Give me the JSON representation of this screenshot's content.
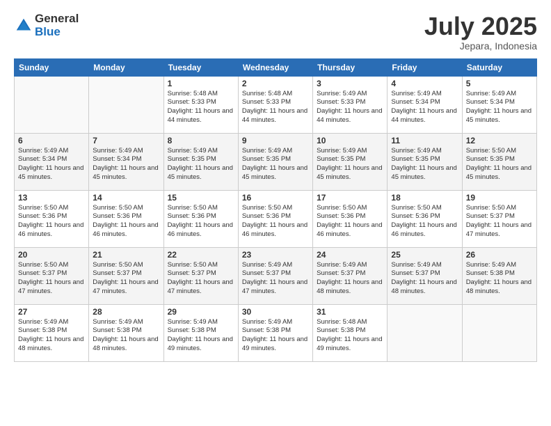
{
  "logo": {
    "general": "General",
    "blue": "Blue"
  },
  "title": "July 2025",
  "location": "Jepara, Indonesia",
  "weekdays": [
    "Sunday",
    "Monday",
    "Tuesday",
    "Wednesday",
    "Thursday",
    "Friday",
    "Saturday"
  ],
  "weeks": [
    [
      {
        "day": "",
        "sunrise": "",
        "sunset": "",
        "daylight": ""
      },
      {
        "day": "",
        "sunrise": "",
        "sunset": "",
        "daylight": ""
      },
      {
        "day": "1",
        "sunrise": "Sunrise: 5:48 AM",
        "sunset": "Sunset: 5:33 PM",
        "daylight": "Daylight: 11 hours and 44 minutes."
      },
      {
        "day": "2",
        "sunrise": "Sunrise: 5:48 AM",
        "sunset": "Sunset: 5:33 PM",
        "daylight": "Daylight: 11 hours and 44 minutes."
      },
      {
        "day": "3",
        "sunrise": "Sunrise: 5:49 AM",
        "sunset": "Sunset: 5:33 PM",
        "daylight": "Daylight: 11 hours and 44 minutes."
      },
      {
        "day": "4",
        "sunrise": "Sunrise: 5:49 AM",
        "sunset": "Sunset: 5:34 PM",
        "daylight": "Daylight: 11 hours and 44 minutes."
      },
      {
        "day": "5",
        "sunrise": "Sunrise: 5:49 AM",
        "sunset": "Sunset: 5:34 PM",
        "daylight": "Daylight: 11 hours and 45 minutes."
      }
    ],
    [
      {
        "day": "6",
        "sunrise": "Sunrise: 5:49 AM",
        "sunset": "Sunset: 5:34 PM",
        "daylight": "Daylight: 11 hours and 45 minutes."
      },
      {
        "day": "7",
        "sunrise": "Sunrise: 5:49 AM",
        "sunset": "Sunset: 5:34 PM",
        "daylight": "Daylight: 11 hours and 45 minutes."
      },
      {
        "day": "8",
        "sunrise": "Sunrise: 5:49 AM",
        "sunset": "Sunset: 5:35 PM",
        "daylight": "Daylight: 11 hours and 45 minutes."
      },
      {
        "day": "9",
        "sunrise": "Sunrise: 5:49 AM",
        "sunset": "Sunset: 5:35 PM",
        "daylight": "Daylight: 11 hours and 45 minutes."
      },
      {
        "day": "10",
        "sunrise": "Sunrise: 5:49 AM",
        "sunset": "Sunset: 5:35 PM",
        "daylight": "Daylight: 11 hours and 45 minutes."
      },
      {
        "day": "11",
        "sunrise": "Sunrise: 5:49 AM",
        "sunset": "Sunset: 5:35 PM",
        "daylight": "Daylight: 11 hours and 45 minutes."
      },
      {
        "day": "12",
        "sunrise": "Sunrise: 5:50 AM",
        "sunset": "Sunset: 5:35 PM",
        "daylight": "Daylight: 11 hours and 45 minutes."
      }
    ],
    [
      {
        "day": "13",
        "sunrise": "Sunrise: 5:50 AM",
        "sunset": "Sunset: 5:36 PM",
        "daylight": "Daylight: 11 hours and 46 minutes."
      },
      {
        "day": "14",
        "sunrise": "Sunrise: 5:50 AM",
        "sunset": "Sunset: 5:36 PM",
        "daylight": "Daylight: 11 hours and 46 minutes."
      },
      {
        "day": "15",
        "sunrise": "Sunrise: 5:50 AM",
        "sunset": "Sunset: 5:36 PM",
        "daylight": "Daylight: 11 hours and 46 minutes."
      },
      {
        "day": "16",
        "sunrise": "Sunrise: 5:50 AM",
        "sunset": "Sunset: 5:36 PM",
        "daylight": "Daylight: 11 hours and 46 minutes."
      },
      {
        "day": "17",
        "sunrise": "Sunrise: 5:50 AM",
        "sunset": "Sunset: 5:36 PM",
        "daylight": "Daylight: 11 hours and 46 minutes."
      },
      {
        "day": "18",
        "sunrise": "Sunrise: 5:50 AM",
        "sunset": "Sunset: 5:36 PM",
        "daylight": "Daylight: 11 hours and 46 minutes."
      },
      {
        "day": "19",
        "sunrise": "Sunrise: 5:50 AM",
        "sunset": "Sunset: 5:37 PM",
        "daylight": "Daylight: 11 hours and 47 minutes."
      }
    ],
    [
      {
        "day": "20",
        "sunrise": "Sunrise: 5:50 AM",
        "sunset": "Sunset: 5:37 PM",
        "daylight": "Daylight: 11 hours and 47 minutes."
      },
      {
        "day": "21",
        "sunrise": "Sunrise: 5:50 AM",
        "sunset": "Sunset: 5:37 PM",
        "daylight": "Daylight: 11 hours and 47 minutes."
      },
      {
        "day": "22",
        "sunrise": "Sunrise: 5:50 AM",
        "sunset": "Sunset: 5:37 PM",
        "daylight": "Daylight: 11 hours and 47 minutes."
      },
      {
        "day": "23",
        "sunrise": "Sunrise: 5:49 AM",
        "sunset": "Sunset: 5:37 PM",
        "daylight": "Daylight: 11 hours and 47 minutes."
      },
      {
        "day": "24",
        "sunrise": "Sunrise: 5:49 AM",
        "sunset": "Sunset: 5:37 PM",
        "daylight": "Daylight: 11 hours and 48 minutes."
      },
      {
        "day": "25",
        "sunrise": "Sunrise: 5:49 AM",
        "sunset": "Sunset: 5:37 PM",
        "daylight": "Daylight: 11 hours and 48 minutes."
      },
      {
        "day": "26",
        "sunrise": "Sunrise: 5:49 AM",
        "sunset": "Sunset: 5:38 PM",
        "daylight": "Daylight: 11 hours and 48 minutes."
      }
    ],
    [
      {
        "day": "27",
        "sunrise": "Sunrise: 5:49 AM",
        "sunset": "Sunset: 5:38 PM",
        "daylight": "Daylight: 11 hours and 48 minutes."
      },
      {
        "day": "28",
        "sunrise": "Sunrise: 5:49 AM",
        "sunset": "Sunset: 5:38 PM",
        "daylight": "Daylight: 11 hours and 48 minutes."
      },
      {
        "day": "29",
        "sunrise": "Sunrise: 5:49 AM",
        "sunset": "Sunset: 5:38 PM",
        "daylight": "Daylight: 11 hours and 49 minutes."
      },
      {
        "day": "30",
        "sunrise": "Sunrise: 5:49 AM",
        "sunset": "Sunset: 5:38 PM",
        "daylight": "Daylight: 11 hours and 49 minutes."
      },
      {
        "day": "31",
        "sunrise": "Sunrise: 5:48 AM",
        "sunset": "Sunset: 5:38 PM",
        "daylight": "Daylight: 11 hours and 49 minutes."
      },
      {
        "day": "",
        "sunrise": "",
        "sunset": "",
        "daylight": ""
      },
      {
        "day": "",
        "sunrise": "",
        "sunset": "",
        "daylight": ""
      }
    ]
  ]
}
